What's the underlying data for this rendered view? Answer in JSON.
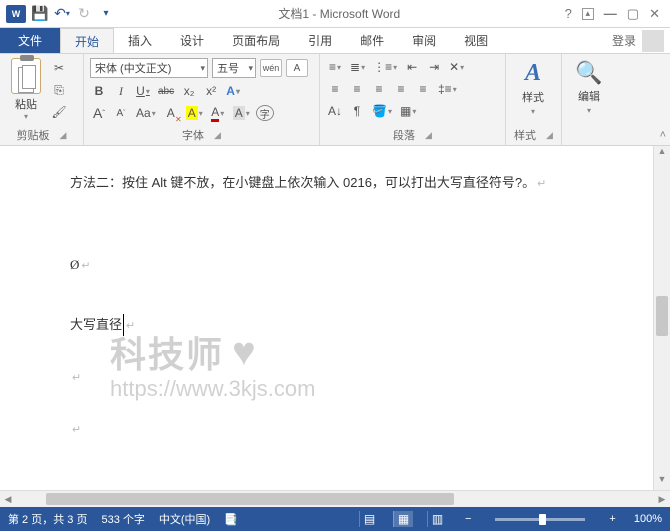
{
  "titlebar": {
    "title": "文档1 - Microsoft Word"
  },
  "tabs": {
    "file": "文件",
    "home": "开始",
    "insert": "插入",
    "design": "设计",
    "layout": "页面布局",
    "references": "引用",
    "mailings": "邮件",
    "review": "审阅",
    "view": "视图",
    "login": "登录"
  },
  "ribbon": {
    "clipboard": {
      "paste": "粘贴",
      "label": "剪贴板"
    },
    "font": {
      "name": "宋体 (中文正文)",
      "size": "五号",
      "label": "字体",
      "bold": "B",
      "italic": "I",
      "underline": "U",
      "strike": "abc",
      "sub": "x₂",
      "sup": "x²",
      "wen": "wén",
      "boxedA": "A",
      "grow": "A",
      "shrink": "A",
      "aa": "Aa",
      "clear": "A",
      "effects": "A",
      "highlight": "A",
      "color": "A"
    },
    "paragraph": {
      "label": "段落"
    },
    "styles": {
      "label": "样式",
      "btn": "样式"
    },
    "editing": {
      "label": "编辑",
      "btn": "编辑"
    }
  },
  "document": {
    "line1": "方法二：按住 Alt 键不放，在小键盘上依次输入 0216，可以打出大写直径符号?。",
    "line2": "Ø",
    "line3": "大写直径"
  },
  "watermark": {
    "brand": "科技师",
    "url": "https://www.3kjs.com"
  },
  "status": {
    "page": "第 2 页，共 3 页",
    "words": "533 个字",
    "lang": "中文(中国)",
    "zoom": "100%"
  }
}
